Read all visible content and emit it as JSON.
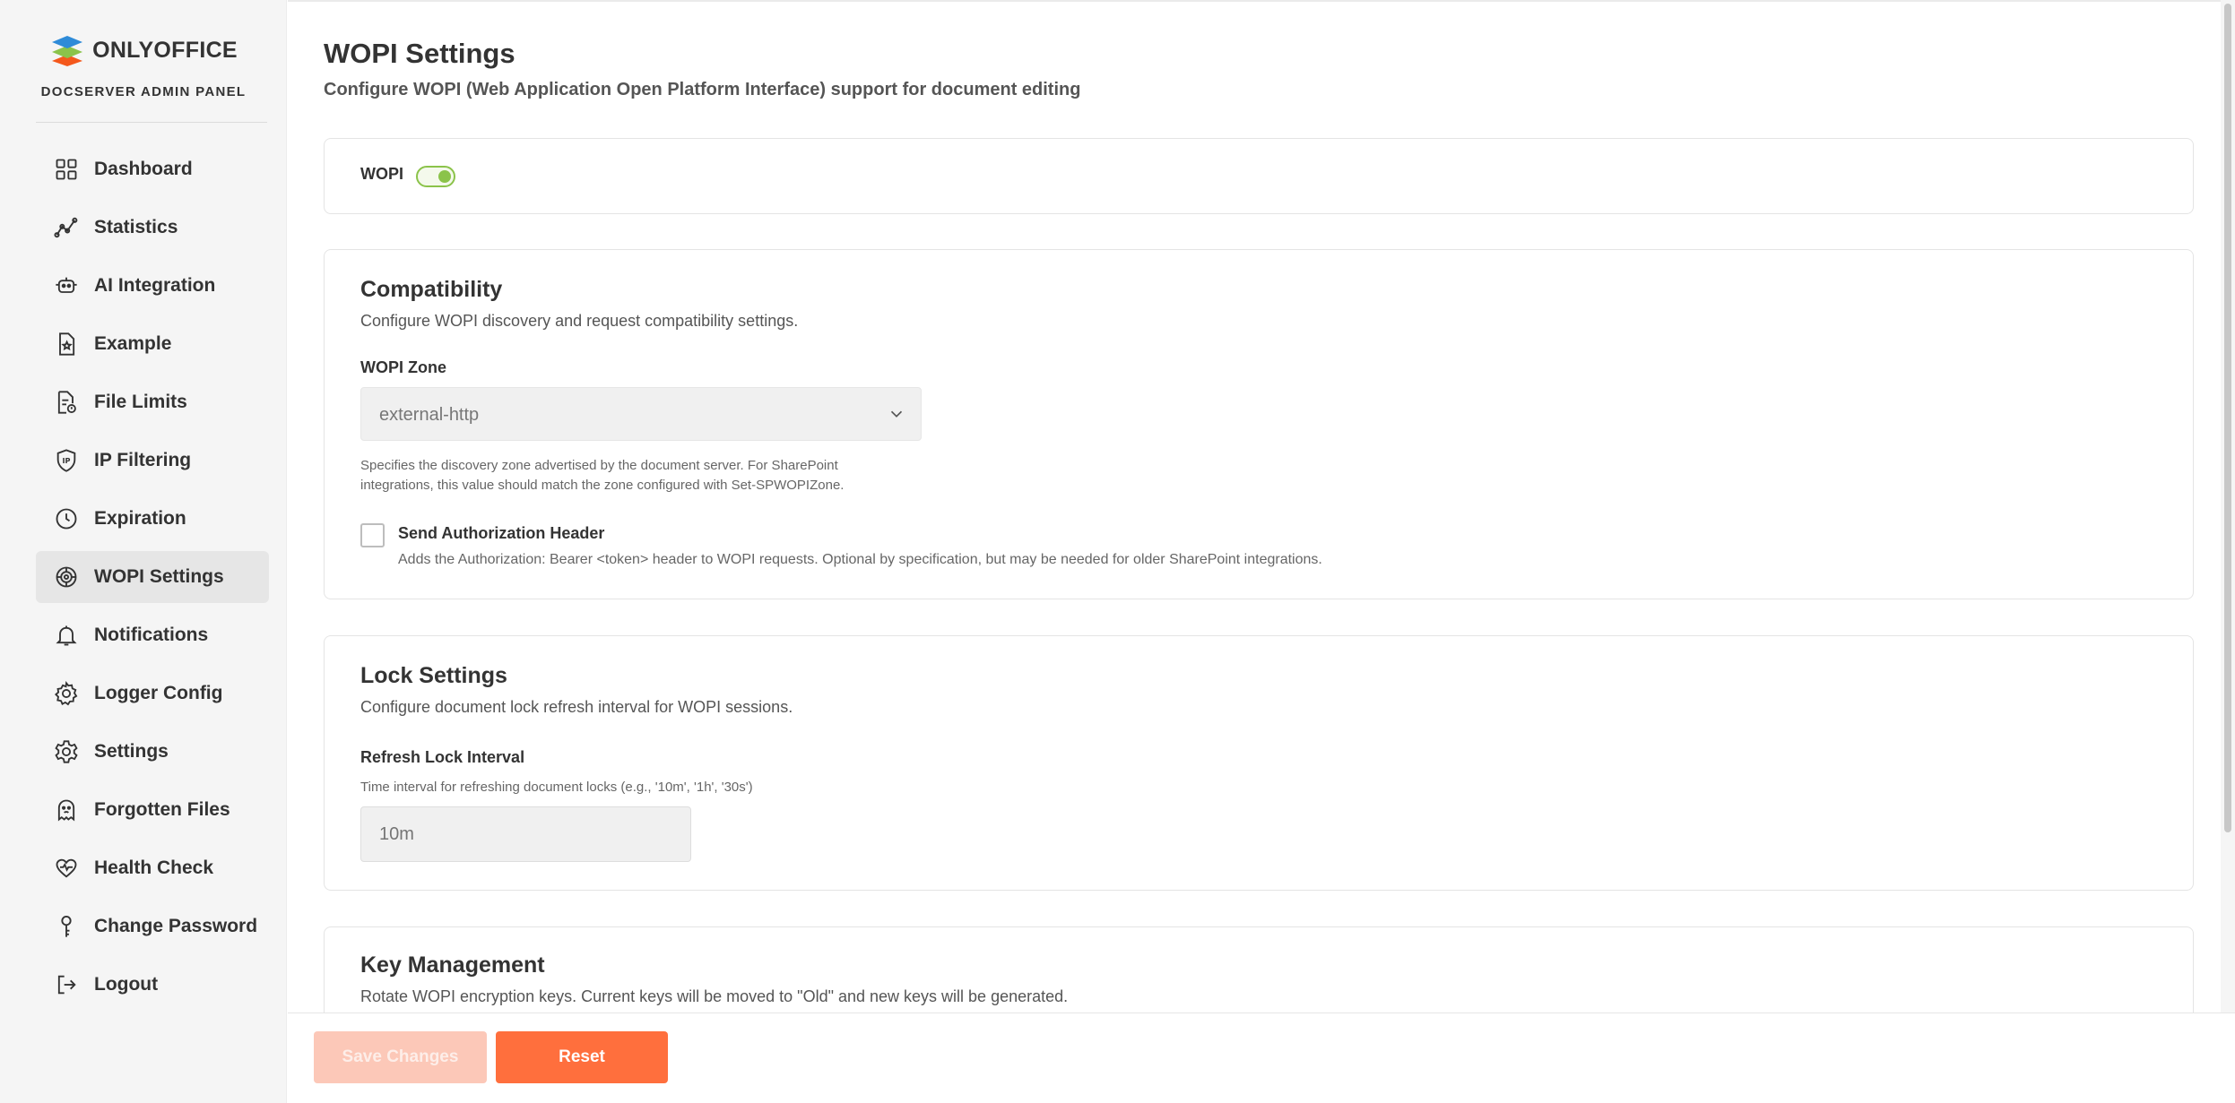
{
  "brand": {
    "name": "ONLYOFFICE",
    "subtitle": "DOCSERVER ADMIN PANEL",
    "colors": [
      "#2e8bd8",
      "#8bc34a",
      "#f4581c"
    ]
  },
  "sidebar": {
    "items": [
      {
        "label": "Dashboard",
        "icon": "dashboard-icon"
      },
      {
        "label": "Statistics",
        "icon": "statistics-icon"
      },
      {
        "label": "AI Integration",
        "icon": "robot-icon"
      },
      {
        "label": "Example",
        "icon": "document-star-icon"
      },
      {
        "label": "File Limits",
        "icon": "file-limits-icon"
      },
      {
        "label": "IP Filtering",
        "icon": "ip-shield-icon"
      },
      {
        "label": "Expiration",
        "icon": "clock-icon"
      },
      {
        "label": "WOPI Settings",
        "icon": "wopi-gear-icon",
        "active": true
      },
      {
        "label": "Notifications",
        "icon": "bell-icon"
      },
      {
        "label": "Logger Config",
        "icon": "logger-gear-icon"
      },
      {
        "label": "Settings",
        "icon": "gear-icon"
      },
      {
        "label": "Forgotten Files",
        "icon": "ghost-icon"
      },
      {
        "label": "Health Check",
        "icon": "heart-pulse-icon"
      },
      {
        "label": "Change Password",
        "icon": "key-icon"
      },
      {
        "label": "Logout",
        "icon": "logout-icon"
      }
    ]
  },
  "page": {
    "title": "WOPI Settings",
    "subtitle": "Configure WOPI (Web Application Open Platform Interface) support for document editing"
  },
  "wopi": {
    "label": "WOPI",
    "enabled": true,
    "accent": "#8bc34a"
  },
  "compatibility": {
    "title": "Compatibility",
    "description": "Configure WOPI discovery and request compatibility settings.",
    "zone_label": "WOPI Zone",
    "zone_value": "external-http",
    "zone_hint_line1": "Specifies the discovery zone advertised by the document server. For SharePoint",
    "zone_hint_line2": "integrations, this value should match the zone configured with Set-SPWOPIZone.",
    "auth_label": "Send Authorization Header",
    "auth_checked": false,
    "auth_hint": "Adds the Authorization: Bearer <token> header to WOPI requests. Optional by specification, but may be needed for older SharePoint integrations."
  },
  "lock": {
    "title": "Lock Settings",
    "description": "Configure document lock refresh interval for WOPI sessions.",
    "interval_label": "Refresh Lock Interval",
    "interval_hint": "Time interval for refreshing document locks (e.g., '10m', '1h', '30s')",
    "interval_placeholder": "10m"
  },
  "keys": {
    "title": "Key Management",
    "description": "Rotate WOPI encryption keys. Current keys will be moved to \"Old\" and new keys will be generated."
  },
  "footer": {
    "save_label": "Save Changes",
    "reset_label": "Reset",
    "accent": "#ff6f3d"
  }
}
